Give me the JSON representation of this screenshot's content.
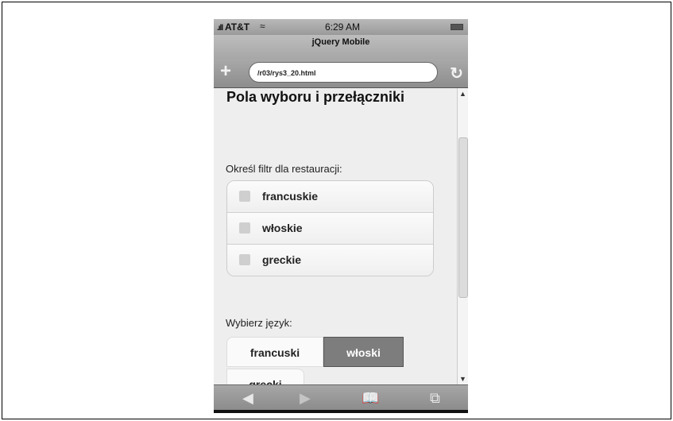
{
  "status": {
    "carrier": "AT&T",
    "time": "6:29 AM"
  },
  "browser": {
    "title": "jQuery Mobile",
    "url": "/r03/rys3_20.html",
    "plus_label": "+",
    "reload_label": "↻"
  },
  "page": {
    "title": "Pola wyboru i przełączniki",
    "filter_label": "Określ filtr dla restauracji:",
    "checkboxes": [
      {
        "label": "francuskie",
        "checked": false
      },
      {
        "label": "włoskie",
        "checked": false
      },
      {
        "label": "greckie",
        "checked": false
      }
    ],
    "language_label": "Wybierz język:",
    "languages": [
      {
        "label": "francuski",
        "selected": false
      },
      {
        "label": "włoski",
        "selected": true
      },
      {
        "label": "grecki",
        "selected": false
      }
    ]
  },
  "toolbar": {
    "back_icon": "◀",
    "forward_icon": "▶",
    "bookmarks_icon": "📖",
    "pages_icon": "⧉"
  },
  "colors": {
    "selected": "#7d7d7d",
    "toolbar": "#999999"
  }
}
